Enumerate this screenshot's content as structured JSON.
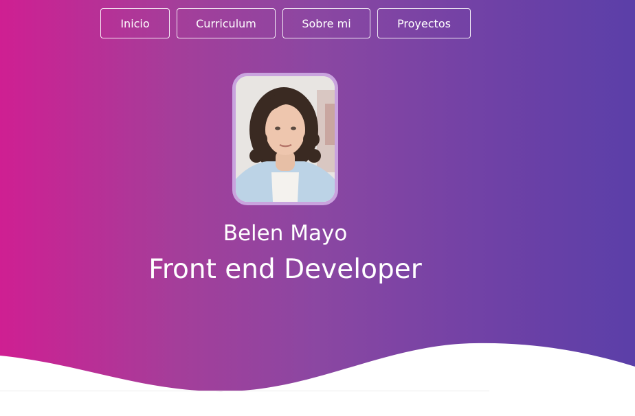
{
  "nav": {
    "items": [
      {
        "label": "Inicio"
      },
      {
        "label": "Curriculum"
      },
      {
        "label": "Sobre mi"
      },
      {
        "label": "Proyectos"
      }
    ]
  },
  "profile": {
    "name": "Belen Mayo",
    "role": "Front end Developer"
  },
  "colors": {
    "gradient_start": "#cf1f92",
    "gradient_end": "#5b3fa8",
    "text": "#ffffff"
  }
}
